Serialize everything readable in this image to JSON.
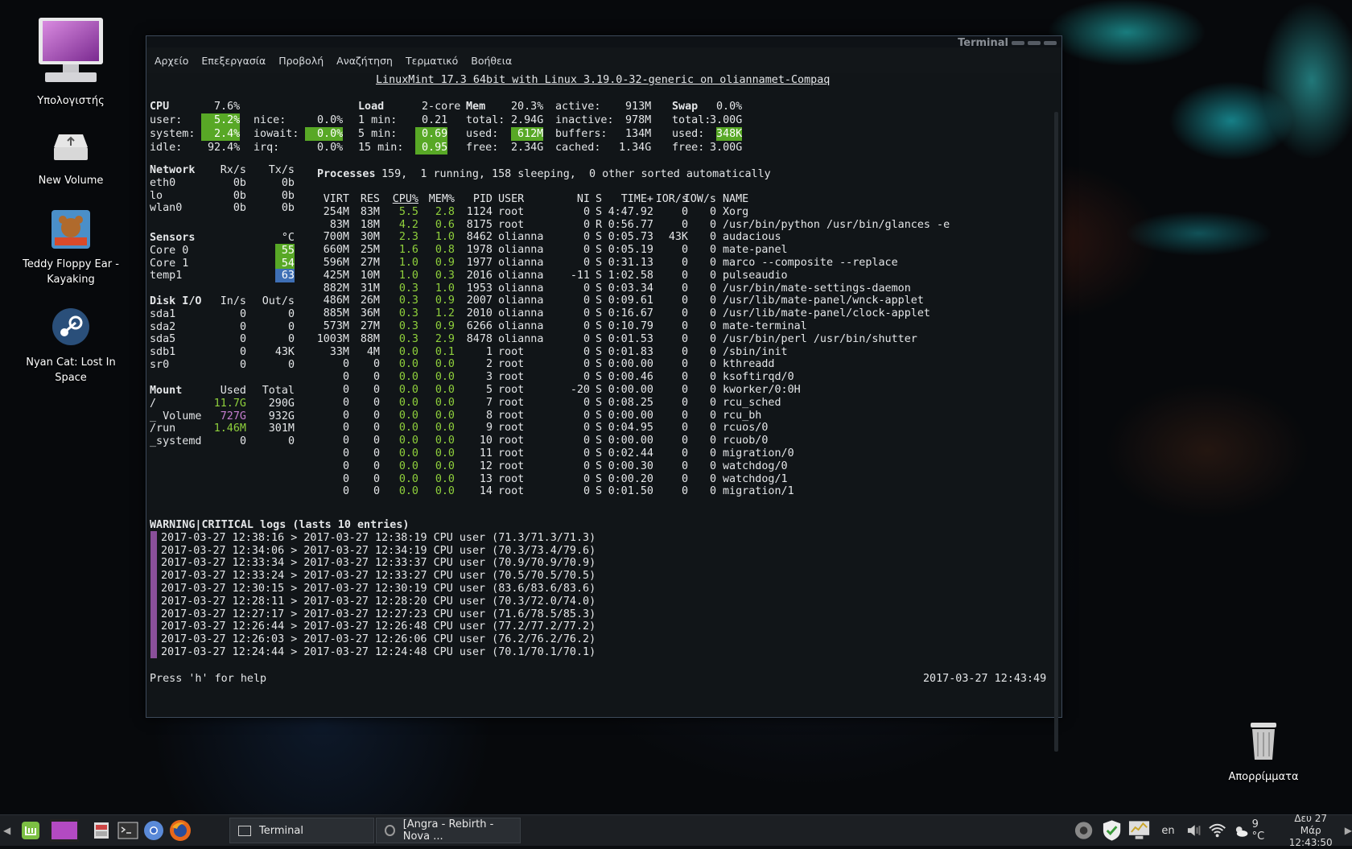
{
  "desktop": {
    "icons": [
      {
        "label": "Υπολογιστής",
        "icon": "computer-monitor-icon"
      },
      {
        "label": "New Volume",
        "icon": "usb-drive-icon"
      },
      {
        "label": "Teddy Floppy Ear - Kayaking",
        "icon": "game-icon"
      },
      {
        "label": "Nyan Cat: Lost In Space",
        "icon": "steam-icon"
      },
      {
        "label": "Απορρίμματα",
        "icon": "trash-icon"
      }
    ]
  },
  "window": {
    "title": "Terminal",
    "menu": [
      "Αρχείο",
      "Επεξεργασία",
      "Προβολή",
      "Αναζήτηση",
      "Τερματικό",
      "Βοήθεια"
    ]
  },
  "glances": {
    "header": "LinuxMint 17.3 64bit with Linux 3.19.0-32-generic on oliannamet-Compaq",
    "cpu": {
      "label": "CPU",
      "total": "7.6%",
      "user_label": "user:",
      "user": "5.2%",
      "system_label": "system:",
      "system": "2.4%",
      "idle_label": "idle:",
      "idle": "92.4%",
      "nice_label": "nice:",
      "nice": "0.0%",
      "iowait_label": "iowait:",
      "iowait": "0.0%",
      "irq_label": "irq:",
      "irq": "0.0%"
    },
    "load": {
      "label": "Load",
      "cores": "2-core",
      "m1_label": "1 min:",
      "m1": "0.21",
      "m5_label": "5 min:",
      "m5": "0.69",
      "m15_label": "15 min:",
      "m15": "0.95"
    },
    "mem": {
      "label": "Mem",
      "percent": "20.3%",
      "total_label": "total:",
      "total": "2.94G",
      "used_label": "used:",
      "used": "612M",
      "free_label": "free:",
      "free": "2.34G",
      "active_label": "active:",
      "active": "913M",
      "inactive_label": "inactive:",
      "inactive": "978M",
      "buffers_label": "buffers:",
      "buffers": "134M",
      "cached_label": "cached:",
      "cached": "1.34G"
    },
    "swap": {
      "label": "Swap",
      "percent": "0.0%",
      "total_label": "total:",
      "total": "3.00G",
      "used_label": "used:",
      "used": "348K",
      "free_label": "free:",
      "free": "3.00G"
    },
    "network": {
      "headers": [
        "Network",
        "Rx/s",
        "Tx/s"
      ],
      "rows": [
        [
          "eth0",
          "0b",
          "0b"
        ],
        [
          "lo",
          "0b",
          "0b"
        ],
        [
          "wlan0",
          "0b",
          "0b"
        ]
      ]
    },
    "sensors": {
      "headers": [
        "Sensors",
        "°C"
      ],
      "rows": [
        [
          "Core 0",
          "55"
        ],
        [
          "Core 1",
          "54"
        ],
        [
          "temp1",
          "63"
        ]
      ]
    },
    "disk": {
      "headers": [
        "Disk I/O",
        "In/s",
        "Out/s"
      ],
      "rows": [
        [
          "sda1",
          "0",
          "0"
        ],
        [
          "sda2",
          "0",
          "0"
        ],
        [
          "sda5",
          "0",
          "0"
        ],
        [
          "sdb1",
          "0",
          "43K"
        ],
        [
          "sr0",
          "0",
          "0"
        ]
      ]
    },
    "mount": {
      "headers": [
        "Mount",
        "Used",
        "Total"
      ],
      "rows": [
        [
          "/",
          "11.7G",
          "290G"
        ],
        [
          "_ Volume",
          "727G",
          "932G"
        ],
        [
          "/run",
          "1.46M",
          "301M"
        ],
        [
          "_systemd",
          "0",
          "0"
        ]
      ]
    },
    "processes": {
      "summary_label": "Processes",
      "summary": "159,  1 running, 158 sleeping,  0 other sorted automatically",
      "headers": [
        "VIRT",
        "RES",
        "CPU%",
        "MEM%",
        "PID",
        "USER",
        "NI",
        "S",
        "TIME+",
        "IOR/s",
        "IOW/s",
        "NAME"
      ],
      "rows": [
        [
          "254M",
          "83M",
          "5.5",
          "2.8",
          "1124",
          "root",
          "0",
          "S",
          "4:47.92",
          "0",
          "0",
          "Xorg"
        ],
        [
          "83M",
          "18M",
          "4.2",
          "0.6",
          "8175",
          "root",
          "0",
          "R",
          "0:56.77",
          "0",
          "0",
          "/usr/bin/python /usr/bin/glances -e"
        ],
        [
          "700M",
          "30M",
          "2.3",
          "1.0",
          "8462",
          "olianna",
          "0",
          "S",
          "0:05.73",
          "43K",
          "0",
          "audacious"
        ],
        [
          "660M",
          "25M",
          "1.6",
          "0.8",
          "1978",
          "olianna",
          "0",
          "S",
          "0:05.19",
          "0",
          "0",
          "mate-panel"
        ],
        [
          "596M",
          "27M",
          "1.0",
          "0.9",
          "1977",
          "olianna",
          "0",
          "S",
          "0:31.13",
          "0",
          "0",
          "marco --composite --replace"
        ],
        [
          "425M",
          "10M",
          "1.0",
          "0.3",
          "2016",
          "olianna",
          "-11",
          "S",
          "1:02.58",
          "0",
          "0",
          "pulseaudio"
        ],
        [
          "882M",
          "31M",
          "0.3",
          "1.0",
          "1953",
          "olianna",
          "0",
          "S",
          "0:03.34",
          "0",
          "0",
          "/usr/bin/mate-settings-daemon"
        ],
        [
          "486M",
          "26M",
          "0.3",
          "0.9",
          "2007",
          "olianna",
          "0",
          "S",
          "0:09.61",
          "0",
          "0",
          "/usr/lib/mate-panel/wnck-applet"
        ],
        [
          "885M",
          "36M",
          "0.3",
          "1.2",
          "2010",
          "olianna",
          "0",
          "S",
          "0:16.67",
          "0",
          "0",
          "/usr/lib/mate-panel/clock-applet"
        ],
        [
          "573M",
          "27M",
          "0.3",
          "0.9",
          "6266",
          "olianna",
          "0",
          "S",
          "0:10.79",
          "0",
          "0",
          "mate-terminal"
        ],
        [
          "1003M",
          "88M",
          "0.3",
          "2.9",
          "8478",
          "olianna",
          "0",
          "S",
          "0:01.53",
          "0",
          "0",
          "/usr/bin/perl /usr/bin/shutter"
        ],
        [
          "33M",
          "4M",
          "0.0",
          "0.1",
          "1",
          "root",
          "0",
          "S",
          "0:01.83",
          "0",
          "0",
          "/sbin/init"
        ],
        [
          "0",
          "0",
          "0.0",
          "0.0",
          "2",
          "root",
          "0",
          "S",
          "0:00.00",
          "0",
          "0",
          "kthreadd"
        ],
        [
          "0",
          "0",
          "0.0",
          "0.0",
          "3",
          "root",
          "0",
          "S",
          "0:00.46",
          "0",
          "0",
          "ksoftirqd/0"
        ],
        [
          "0",
          "0",
          "0.0",
          "0.0",
          "5",
          "root",
          "-20",
          "S",
          "0:00.00",
          "0",
          "0",
          "kworker/0:0H"
        ],
        [
          "0",
          "0",
          "0.0",
          "0.0",
          "7",
          "root",
          "0",
          "S",
          "0:08.25",
          "0",
          "0",
          "rcu_sched"
        ],
        [
          "0",
          "0",
          "0.0",
          "0.0",
          "8",
          "root",
          "0",
          "S",
          "0:00.00",
          "0",
          "0",
          "rcu_bh"
        ],
        [
          "0",
          "0",
          "0.0",
          "0.0",
          "9",
          "root",
          "0",
          "S",
          "0:04.95",
          "0",
          "0",
          "rcuos/0"
        ],
        [
          "0",
          "0",
          "0.0",
          "0.0",
          "10",
          "root",
          "0",
          "S",
          "0:00.00",
          "0",
          "0",
          "rcuob/0"
        ],
        [
          "0",
          "0",
          "0.0",
          "0.0",
          "11",
          "root",
          "0",
          "S",
          "0:02.44",
          "0",
          "0",
          "migration/0"
        ],
        [
          "0",
          "0",
          "0.0",
          "0.0",
          "12",
          "root",
          "0",
          "S",
          "0:00.30",
          "0",
          "0",
          "watchdog/0"
        ],
        [
          "0",
          "0",
          "0.0",
          "0.0",
          "13",
          "root",
          "0",
          "S",
          "0:00.20",
          "0",
          "0",
          "watchdog/1"
        ],
        [
          "0",
          "0",
          "0.0",
          "0.0",
          "14",
          "root",
          "0",
          "S",
          "0:01.50",
          "0",
          "0",
          "migration/1"
        ]
      ]
    },
    "logs": {
      "title": "WARNING|CRITICAL logs (lasts 10 entries)",
      "entries": [
        "2017-03-27 12:38:16 > 2017-03-27 12:38:19 CPU user (71.3/71.3/71.3)",
        "2017-03-27 12:34:06 > 2017-03-27 12:34:19 CPU user (70.3/73.4/79.6)",
        "2017-03-27 12:33:34 > 2017-03-27 12:33:37 CPU user (70.9/70.9/70.9)",
        "2017-03-27 12:33:24 > 2017-03-27 12:33:27 CPU user (70.5/70.5/70.5)",
        "2017-03-27 12:30:15 > 2017-03-27 12:30:19 CPU user (83.6/83.6/83.6)",
        "2017-03-27 12:28:11 > 2017-03-27 12:28:20 CPU user (70.3/72.0/74.0)",
        "2017-03-27 12:27:17 > 2017-03-27 12:27:23 CPU user (71.6/78.5/85.3)",
        "2017-03-27 12:26:44 > 2017-03-27 12:26:48 CPU user (77.2/77.2/77.2)",
        "2017-03-27 12:26:03 > 2017-03-27 12:26:06 CPU user (76.2/76.2/76.2)",
        "2017-03-27 12:24:44 > 2017-03-27 12:24:48 CPU user (70.1/70.1/70.1)"
      ]
    },
    "help": "Press 'h' for help",
    "timestamp": "2017-03-27 12:43:49"
  },
  "taskbar": {
    "tasks": [
      "Terminal",
      "[Angra - Rebirth - Nova ..."
    ],
    "keyboard_layout": "en",
    "weather": "9 °C",
    "clock_date": "Δευ 27 Μάρ",
    "clock_time": "12:43:50"
  },
  "colors": {
    "highlight_green": "#58a826",
    "green_text": "#8fd03c",
    "sensor_blue": "#3e6fb5",
    "log_purple": "#8a4f9a"
  }
}
